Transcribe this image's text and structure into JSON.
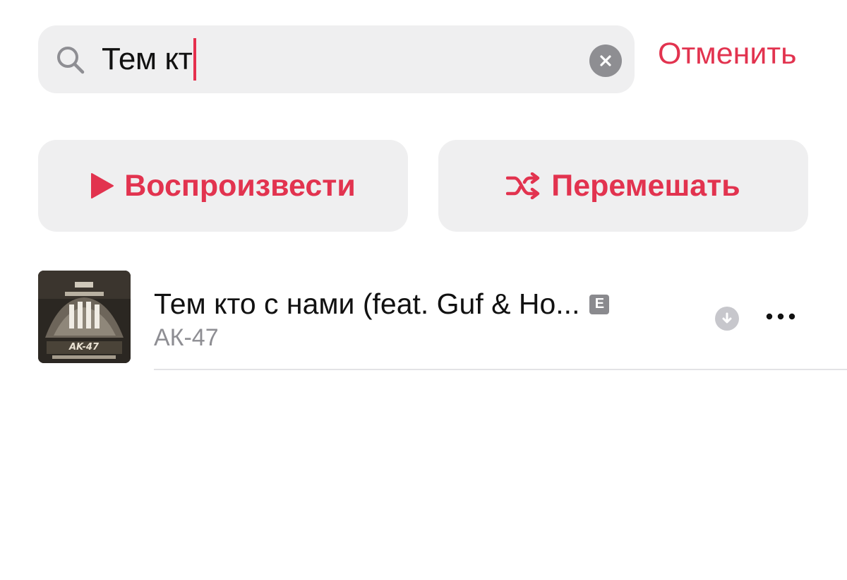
{
  "search": {
    "query": "Тем кт",
    "cancel_label": "Отменить"
  },
  "actions": {
    "play_label": "Воспроизвести",
    "shuffle_label": "Перемешать"
  },
  "results": [
    {
      "title": "Тем кто с нами (feat. Guf & Но...",
      "explicit_badge": "E",
      "artist": "АК-47",
      "artwork_text": "AK-47"
    }
  ],
  "colors": {
    "accent": "#e2334f",
    "field_background": "#efeff0",
    "secondary_text": "#8e8e93"
  },
  "icons": {
    "search": "search-icon",
    "clear": "clear-icon",
    "play": "play-icon",
    "shuffle": "shuffle-icon",
    "download": "download-icon",
    "more": "more-icon"
  }
}
